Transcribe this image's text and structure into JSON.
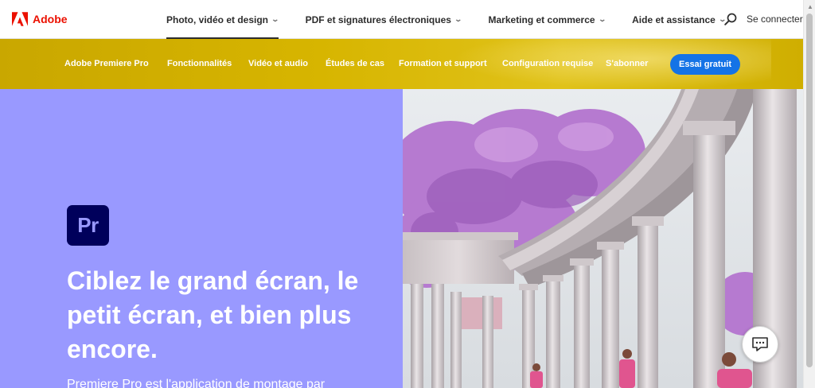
{
  "brand": {
    "name": "Adobe",
    "color": "#eb1000"
  },
  "global_nav": {
    "items": [
      {
        "label": "Photo, vidéo et design",
        "active": true
      },
      {
        "label": "PDF et signatures électroniques",
        "active": false
      },
      {
        "label": "Marketing et commerce",
        "active": false
      },
      {
        "label": "Aide et assistance",
        "active": false
      }
    ],
    "search_icon": "search-icon",
    "signin_label": "Se connecter"
  },
  "local_nav": {
    "product": "Adobe Premiere Pro",
    "items": [
      "Fonctionnalités",
      "Vidéo et audio",
      "Études de cas",
      "Formation et support",
      "Configuration requise",
      "S'abonner"
    ],
    "cta_label": "Essai gratuit",
    "cta_color": "#1473e6"
  },
  "hero": {
    "app_icon_text": "Pr",
    "headline_lines": [
      "Ciblez le grand écran, le",
      "petit écran, et bien plus",
      "encore."
    ],
    "body": "Premiere Pro est l'application de montage par",
    "background_color": "#9999ff",
    "icon_color": "#00005b"
  },
  "chat_icon": "chat-icon"
}
